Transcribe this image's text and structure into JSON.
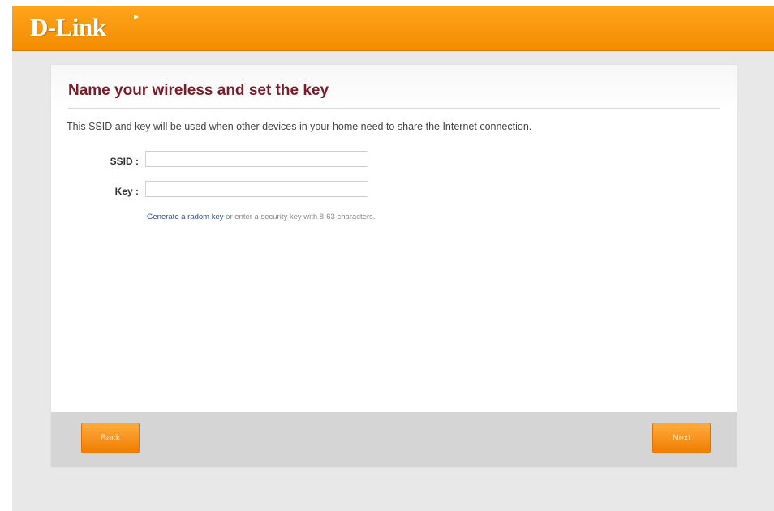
{
  "brand": {
    "logo_text": "D-Link"
  },
  "wizard": {
    "title": "Name your wireless and set the key",
    "description": "This SSID and key will be used when other devices in your home need to share the Internet connection.",
    "ssid": {
      "label": "SSID :",
      "value": ""
    },
    "key": {
      "label": "Key :",
      "value": ""
    },
    "hint": {
      "link_text": "Generate a radom key",
      "text": " or enter a security key with 8-63 characters."
    },
    "buttons": {
      "back": "Back",
      "next": "Next"
    }
  },
  "colors": {
    "header": "#f7941d",
    "title": "#7a1c2a",
    "button": "#f7941d",
    "link": "#2a4d9c"
  }
}
